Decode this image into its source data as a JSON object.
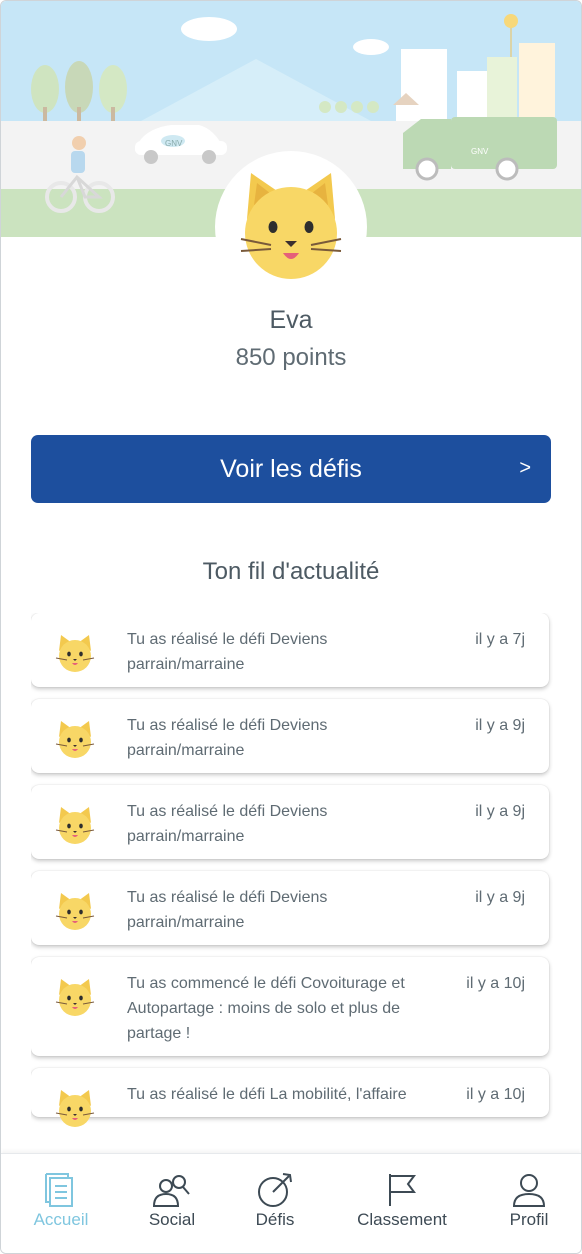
{
  "profile": {
    "name": "Eva",
    "points": "850 points"
  },
  "cta": {
    "label": "Voir les défis",
    "chevron": ">"
  },
  "feed": {
    "title": "Ton fil d'actualité",
    "items": [
      {
        "text": "Tu as réalisé le défi Deviens parrain/marraine",
        "time": "il y a 7j"
      },
      {
        "text": "Tu as réalisé le défi Deviens parrain/marraine",
        "time": "il y a 9j"
      },
      {
        "text": "Tu as réalisé le défi Deviens parrain/marraine",
        "time": "il y a 9j"
      },
      {
        "text": "Tu as réalisé le défi Deviens parrain/marraine",
        "time": "il y a 9j"
      },
      {
        "text": "Tu as commencé le défi Covoiturage et Autopartage : moins de solo et plus de partage !",
        "time": "il y a 10j"
      },
      {
        "text": "Tu as réalisé le défi La mobilité, l'affaire",
        "time": "il y a 10j"
      }
    ]
  },
  "banner": {
    "vehicle_badge": "GNV"
  },
  "tabs": [
    {
      "label": "Accueil",
      "icon": "document-icon",
      "active": true
    },
    {
      "label": "Social",
      "icon": "people-search-icon",
      "active": false
    },
    {
      "label": "Défis",
      "icon": "target-arrow-icon",
      "active": false
    },
    {
      "label": "Classement",
      "icon": "flag-icon",
      "active": false
    },
    {
      "label": "Profil",
      "icon": "person-icon",
      "active": false
    }
  ],
  "colors": {
    "primary": "#1d4f9e",
    "active_tab": "#7fc6df",
    "sky": "#bfe3f6",
    "grass": "#c9e2bc",
    "cat": "#f8d766"
  }
}
